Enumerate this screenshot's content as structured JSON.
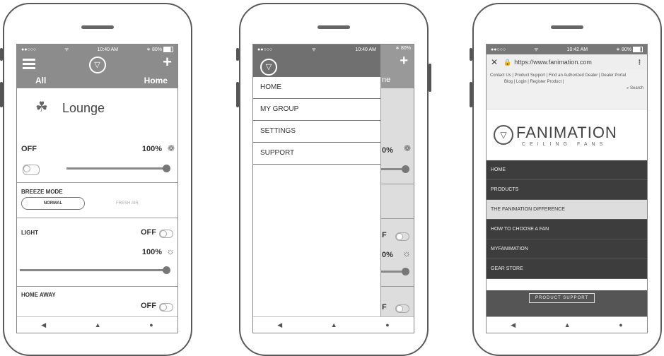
{
  "phone1": {
    "status": {
      "carrier": "●●○○○",
      "wifi": "ᯤ",
      "time": "10:40 AM",
      "bt": "∗",
      "battery": "80%"
    },
    "tabs": {
      "all": "All",
      "home": "Home"
    },
    "room": "Lounge",
    "fan": {
      "state": "OFF",
      "percent": "100%"
    },
    "breeze": {
      "label": "BREEZE MODE",
      "normal": "NORMAL",
      "fresh": "FRESH AIR"
    },
    "light": {
      "label": "LIGHT",
      "state": "OFF",
      "percent": "100%"
    },
    "homeaway": {
      "label": "HOME AWAY",
      "state": "OFF"
    }
  },
  "phone2": {
    "status": {
      "carrier": "●●○○○",
      "wifi": "ᯤ",
      "time": "10:40 AM",
      "bt": "∗",
      "battery": "80%"
    },
    "menu": [
      "HOME",
      "MY GROUP",
      "SETTINGS",
      "SUPPORT"
    ],
    "behind": {
      "tab": "ne",
      "fan_pct": "0%",
      "off": "F",
      "light_pct": "0%"
    }
  },
  "phone3": {
    "status": {
      "carrier": "●●○○○",
      "wifi": "ᯤ",
      "time": "10:42 AM",
      "bt": "∗",
      "battery": "80%"
    },
    "url": "https://www.fanimation.com",
    "toplinks": "Contact Us  |  Product Support  |  Find an Authorized Dealer  |  Dealer Portal",
    "toplinks2": "Blog  |  Login  |  Register Product  |",
    "search": "Search",
    "brand": "FANIMATION",
    "tagline": "CEILING FANS",
    "menu": [
      "HOME",
      "PRODUCTS",
      "THE FANIMATION DIFFERENCE",
      "HOW TO CHOOSE A FAN",
      "MYFANIMATION",
      "GEAR STORE"
    ],
    "banner": "PRODUCT SUPPORT"
  },
  "nav": {
    "back": "◀",
    "home": "▲",
    "recent": "●"
  }
}
